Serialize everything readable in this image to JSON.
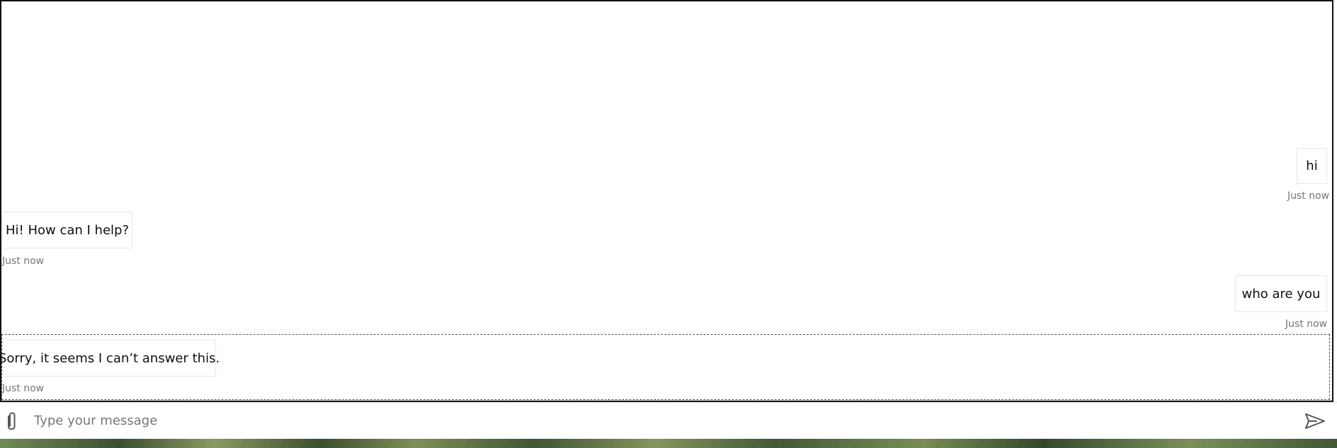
{
  "conversation": {
    "messages": [
      {
        "author": "user",
        "text": "hi",
        "timestamp": "Just now"
      },
      {
        "author": "bot",
        "text": "Hi! How can I help?",
        "timestamp": "Just now"
      },
      {
        "author": "user",
        "text": "who are you",
        "timestamp": "Just now"
      },
      {
        "author": "bot",
        "text": "Sorry, it seems I can’t answer this.",
        "timestamp": "Just now"
      }
    ]
  },
  "composer": {
    "placeholder": "Type your message",
    "value": "",
    "attach_icon": "paperclip-icon",
    "send_icon": "send-icon"
  },
  "colors": {
    "text": "#111111",
    "timestamp": "#767676",
    "border": "#e6e6e6",
    "focus_outline": "#555555",
    "window_border": "#111111"
  }
}
